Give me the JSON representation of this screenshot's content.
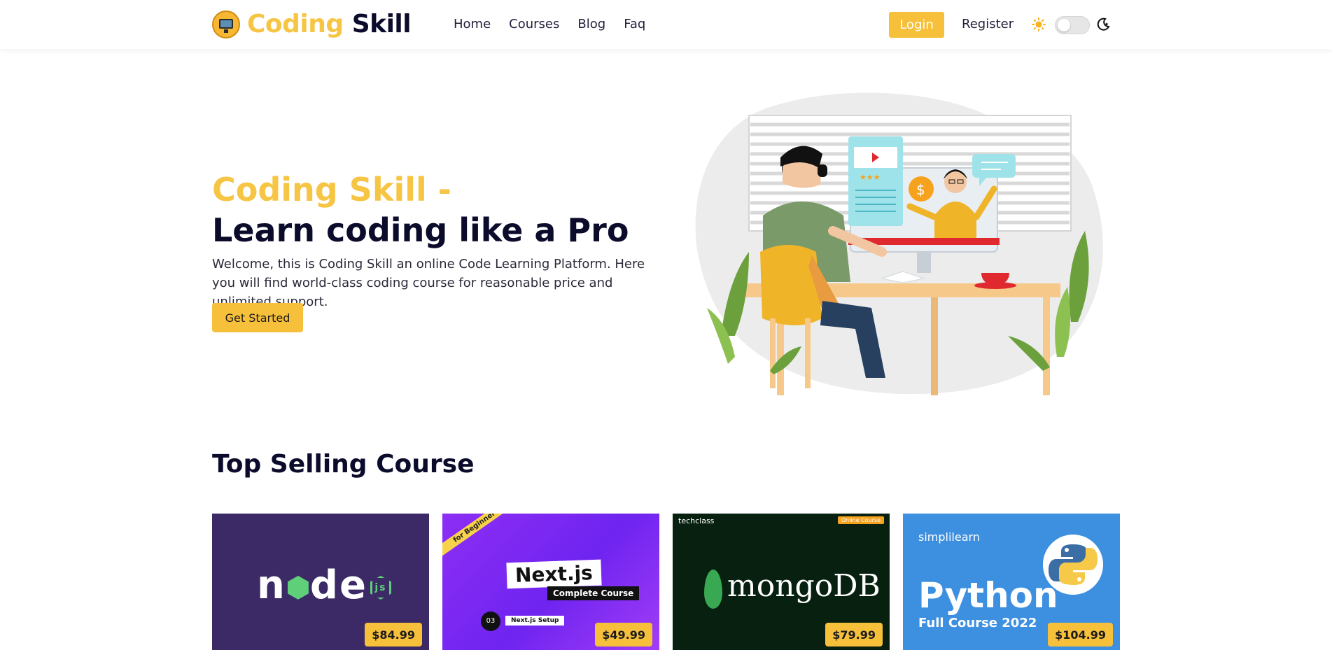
{
  "brand": {
    "name_part1": "Coding",
    "name_part2": "Skill"
  },
  "nav": {
    "links": [
      "Home",
      "Courses",
      "Blog",
      "Faq"
    ],
    "login": "Login",
    "register": "Register"
  },
  "hero": {
    "title_line1": "Coding Skill -",
    "title_line2": "Learn coding like a Pro",
    "description": "Welcome, this is Coding Skill an online Code Learning Platform. Here you will find world-class coding course for reasonable price and unlimited support.",
    "cta": "Get Started"
  },
  "section": {
    "title": "Top Selling Course"
  },
  "courses": [
    {
      "name": "Node.js",
      "price": "$84.99"
    },
    {
      "name": "Next.js",
      "price": "$49.99",
      "banner_title": "Next.js",
      "banner_sub": "Complete Course",
      "ribbon": "for Beginners",
      "step_num": "03",
      "step_label": "Next.js Setup"
    },
    {
      "name": "MongoDB",
      "price": "$79.99",
      "publisher": "techclass",
      "tag": "Online Course",
      "logo_text": "mongoDB"
    },
    {
      "name": "Python",
      "price": "$104.99",
      "publisher": "simplilearn",
      "title": "Python",
      "sub": "Full Course 2022"
    }
  ],
  "colors": {
    "accent": "#f7c03b",
    "brand_yellow": "#f7c544",
    "dark_text": "#0b0b2b"
  },
  "icons": {
    "theme_light": "sun-icon",
    "theme_dark": "moon-icon"
  }
}
